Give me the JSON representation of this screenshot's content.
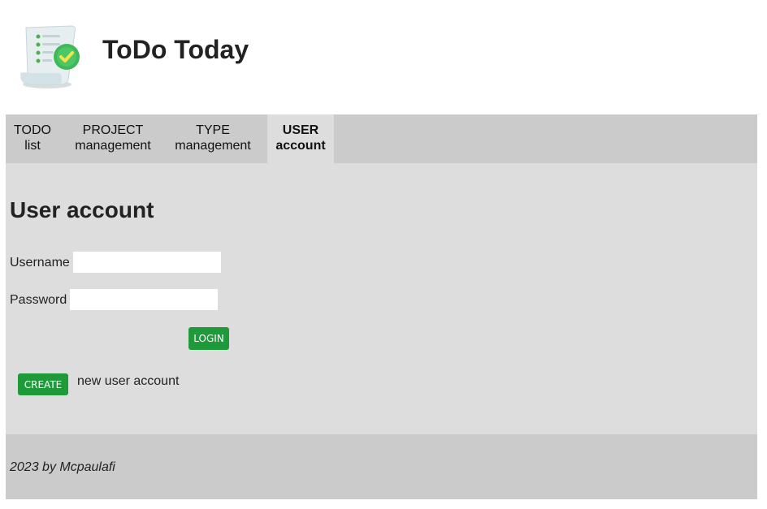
{
  "header": {
    "title": "ToDo Today",
    "logo_icon": "checklist-scroll-icon"
  },
  "nav": {
    "tabs": [
      {
        "line1": "TODO",
        "line2": "list",
        "active": false
      },
      {
        "line1": "PROJECT",
        "line2": "management",
        "active": false
      },
      {
        "line1": "TYPE",
        "line2": "management",
        "active": false
      },
      {
        "line1": "USER",
        "line2": "account",
        "active": true
      }
    ]
  },
  "main": {
    "title": "User account",
    "username_label": "Username",
    "username_value": "",
    "password_label": "Password",
    "password_value": "",
    "login_label": "LOGIN",
    "create_label": "CREATE",
    "create_text": "new user account"
  },
  "footer": {
    "text": "2023 by Mcpaulafi"
  },
  "colors": {
    "accent_green": "#1e9a3a",
    "nav_bg": "#cbcbcb",
    "main_bg": "#dddddd"
  }
}
